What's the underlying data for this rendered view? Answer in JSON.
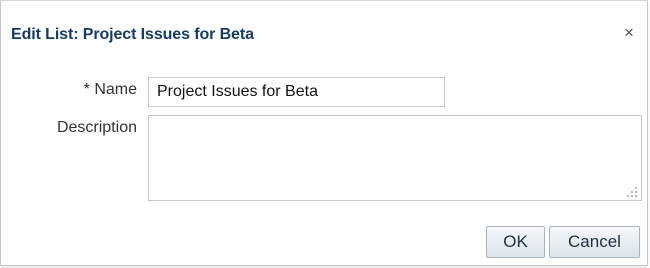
{
  "dialog": {
    "title": "Edit List: Project Issues for Beta",
    "close_glyph": "×"
  },
  "form": {
    "name_required_marker": "*",
    "name_label": "Name",
    "name_value": "Project Issues for Beta",
    "description_label": "Description",
    "description_value": ""
  },
  "buttons": {
    "ok_label": "OK",
    "cancel_label": "Cancel"
  },
  "icons": {
    "close": "close-icon",
    "resize": "resize-grip-icon"
  },
  "colors": {
    "title": "#173c63",
    "button_border": "#a7b4c2"
  }
}
